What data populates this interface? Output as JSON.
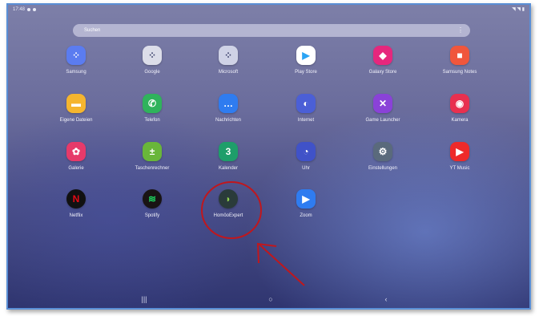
{
  "status": {
    "time": "17:48",
    "right_glyphs": "◥ ◥ ▮"
  },
  "search": {
    "placeholder": "Suchen",
    "more_icon": "⋮"
  },
  "apps": [
    {
      "label": "Samsung",
      "icon": "folder-icon",
      "glyph": "⁘",
      "color": "#5b7cf0"
    },
    {
      "label": "Google",
      "icon": "folder-icon",
      "glyph": "⁘",
      "color": "#dcdde9"
    },
    {
      "label": "Microsoft",
      "icon": "folder-icon",
      "glyph": "⁘",
      "color": "#cfd2e6"
    },
    {
      "label": "Play Store",
      "icon": "play-store-icon",
      "glyph": "▶",
      "color": "#ffffff"
    },
    {
      "label": "Galaxy Store",
      "icon": "galaxy-store-icon",
      "glyph": "◆",
      "color": "#e6277d"
    },
    {
      "label": "Samsung Notes",
      "icon": "samsung-notes-icon",
      "glyph": "■",
      "color": "#f0563c"
    },
    {
      "label": "Eigene Dateien",
      "icon": "folder-files-icon",
      "glyph": "▬",
      "color": "#f5b52f"
    },
    {
      "label": "Telefon",
      "icon": "phone-icon",
      "glyph": "✆",
      "color": "#2fb35c"
    },
    {
      "label": "Nachrichten",
      "icon": "messages-icon",
      "glyph": "…",
      "color": "#2f7cf0"
    },
    {
      "label": "Internet",
      "icon": "internet-icon",
      "glyph": "◐",
      "color": "#4b5fd6"
    },
    {
      "label": "Game Launcher",
      "icon": "game-launcher-icon",
      "glyph": "✕",
      "color": "#8a42d8"
    },
    {
      "label": "Kamera",
      "icon": "camera-icon",
      "glyph": "◉",
      "color": "#e8304f"
    },
    {
      "label": "Galerie",
      "icon": "gallery-icon",
      "glyph": "✿",
      "color": "#e63a6a"
    },
    {
      "label": "Taschenrechner",
      "icon": "calculator-icon",
      "glyph": "±",
      "color": "#69b63a"
    },
    {
      "label": "Kalender",
      "icon": "calendar-icon",
      "glyph": "3",
      "color": "#1e9e6a"
    },
    {
      "label": "Uhr",
      "icon": "clock-icon",
      "glyph": "◔",
      "color": "#4052c8"
    },
    {
      "label": "Einstellungen",
      "icon": "settings-gear-icon",
      "glyph": "⚙",
      "color": "#5a6a7c"
    },
    {
      "label": "YT Music",
      "icon": "yt-music-icon",
      "glyph": "▶",
      "color": "#ee2a2a"
    },
    {
      "label": "Netflix",
      "icon": "netflix-icon",
      "glyph": "N",
      "color": "#111111"
    },
    {
      "label": "Spotify",
      "icon": "spotify-icon",
      "glyph": "≋",
      "color": "#191414"
    },
    {
      "label": "HomöoExpert",
      "icon": "homoeoexpert-icon",
      "glyph": "◗",
      "color": "#2a3b3a"
    },
    {
      "label": "Zoom",
      "icon": "zoom-icon",
      "glyph": "▶",
      "color": "#2f7cf0"
    }
  ],
  "nav": {
    "recents": "|||",
    "home": "○",
    "back": "‹"
  },
  "annotation": {
    "circle_color": "#c0171d",
    "arrow_color": "#c0171d"
  }
}
